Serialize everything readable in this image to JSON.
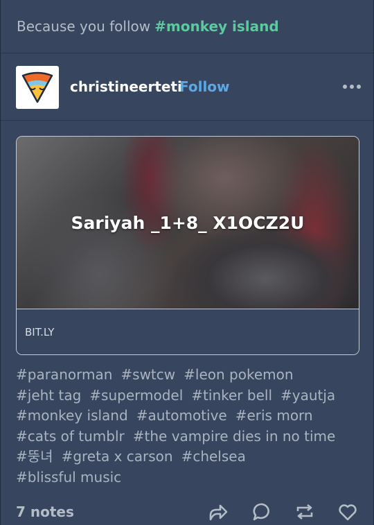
{
  "reason": {
    "prefix": "Because you follow",
    "tag": "#monkey island"
  },
  "post": {
    "avatar_icon": "pizza-slice-face-icon",
    "username": "christineerteti",
    "follow_label": "Follow",
    "more_icon": "more-options-icon",
    "link": {
      "title": "Sariyah _1+8_ X1OCZ2U",
      "host": "BIT.LY"
    },
    "tags": [
      "#paranorman",
      "#swtcw",
      "#leon pokemon",
      "#jeht tag",
      "#supermodel",
      "#tinker bell",
      "#yautja",
      "#monkey island",
      "#automotive",
      "#eris morn",
      "#cats of tumblr",
      "#the vampire dies in no time",
      "#뚱녀",
      "#greta x carson",
      "#chelsea",
      "#blissful music"
    ],
    "notes": "7 notes",
    "actions": [
      "share-icon",
      "reply-icon",
      "reblog-icon",
      "like-icon"
    ]
  },
  "colors": {
    "card_bg": "#37465e",
    "tag_accent": "#5fc8a1",
    "follow": "#5aa9e6",
    "muted_text": "#aab3c0"
  }
}
